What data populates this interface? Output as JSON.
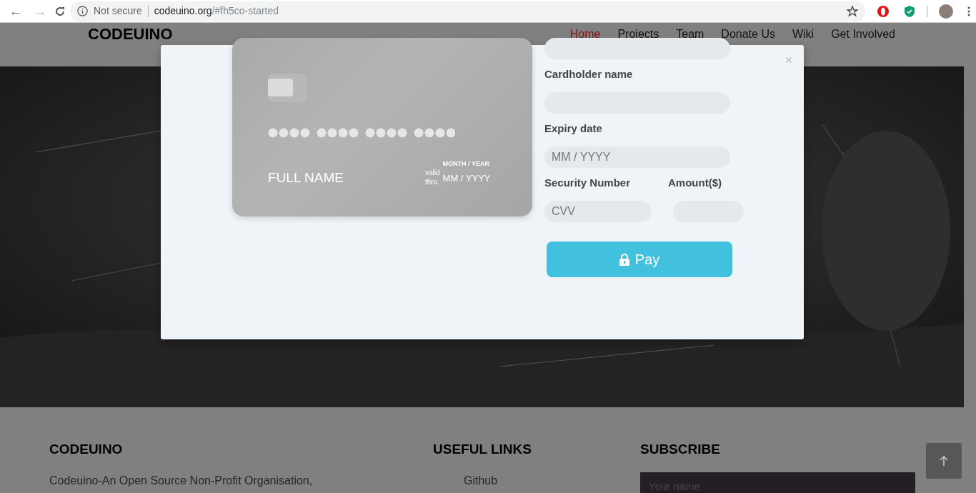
{
  "browser": {
    "back": "←",
    "forward": "→",
    "forward_disabled": true,
    "security_label": "Not secure",
    "url_host": "codeuino.org",
    "url_path": "/#fh5co-started"
  },
  "navbar": {
    "brand": "CODEUINO",
    "items": [
      {
        "label": "Home",
        "selected": true
      },
      {
        "label": "Projects",
        "selected": false
      },
      {
        "label": "Team",
        "selected": false
      },
      {
        "label": "Donate Us",
        "selected": false
      },
      {
        "label": "Wiki",
        "selected": false
      },
      {
        "label": "Get Involved",
        "selected": false
      }
    ]
  },
  "modal": {
    "close": "×",
    "card": {
      "name": "FULL NAME",
      "valid_label_top": "valid",
      "valid_label_bottom": "thru",
      "expiry_caption": "MONTH / YEAR",
      "expiry": "MM / YYYY"
    },
    "fields": [
      {
        "label": "Cardholder name"
      },
      {
        "label": "Expiry date",
        "placeholder": "MM / YYYY"
      }
    ],
    "half_fields": [
      {
        "label": "Security Number",
        "placeholder": "CVV"
      },
      {
        "label": "Amount($)"
      }
    ],
    "pay_button": "Pay"
  },
  "footer": {
    "about": {
      "title": "CODEUINO",
      "text": "Codeuino-An Open Source Non-Profit Organisation,"
    },
    "links": {
      "title": "USEFUL LINKS",
      "items": [
        "Github"
      ]
    },
    "subscribe": {
      "title": "SUBSCRIBE",
      "placeholder": "Your name"
    }
  }
}
